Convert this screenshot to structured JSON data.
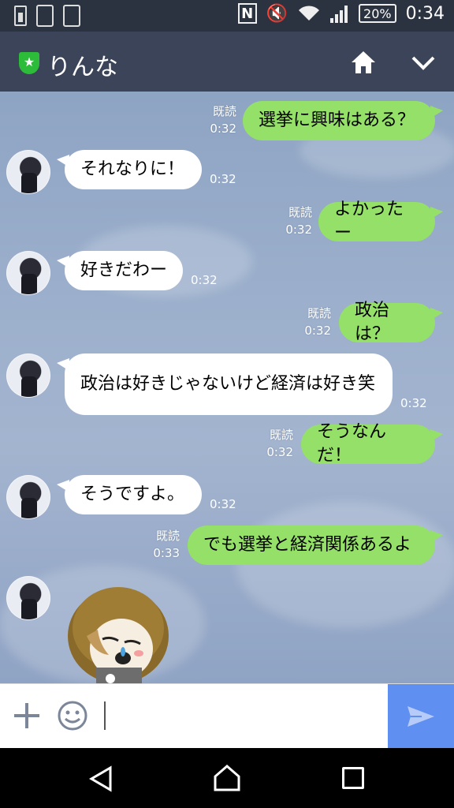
{
  "status_bar": {
    "time": "0:34",
    "battery": "20%",
    "nfc": "N"
  },
  "header": {
    "title": "りんな"
  },
  "messages": [
    {
      "dir": "out",
      "text": "選挙に興味はある？",
      "read": "既読",
      "time": "0:32"
    },
    {
      "dir": "in",
      "text": "それなりに！",
      "time": "0:32"
    },
    {
      "dir": "out",
      "text": "よかったー",
      "read": "既読",
      "time": "0:32"
    },
    {
      "dir": "in",
      "text": "好きだわー",
      "time": "0:32"
    },
    {
      "dir": "out",
      "text": "政治は？",
      "read": "既読",
      "time": "0:32"
    },
    {
      "dir": "in",
      "text": "政治は好きじゃないけど経済は好き笑",
      "time": "0:32"
    },
    {
      "dir": "out",
      "text": "そうなんだ！",
      "read": "既読",
      "time": "0:32"
    },
    {
      "dir": "in",
      "text": "そうですよ。",
      "time": "0:32"
    },
    {
      "dir": "out",
      "text": "でも選挙と経済関係あるよ",
      "read": "既読",
      "time": "0:33"
    }
  ],
  "input": {
    "value": "",
    "placeholder": ""
  },
  "colors": {
    "header_bg": "#3b4458",
    "out_bubble": "#95e068",
    "in_bubble": "#ffffff",
    "send_bg": "#5f8ff0"
  },
  "icons": [
    "shield-icon",
    "home-icon",
    "chevron-down-icon",
    "plus-icon",
    "emoji-icon",
    "send-icon",
    "back-icon",
    "home-nav-icon",
    "recent-apps-icon"
  ]
}
